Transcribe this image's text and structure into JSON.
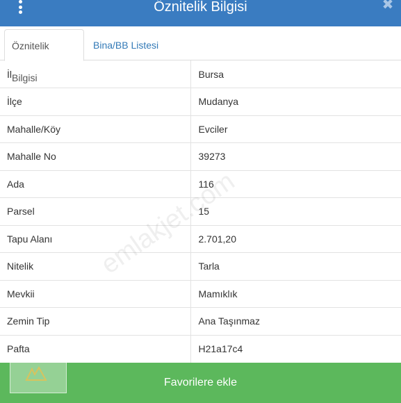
{
  "header": {
    "title": "Öznitelik Bilgisi",
    "close_symbol": "✖"
  },
  "tabs": [
    {
      "label": "Öznitelik Bilgisi",
      "active": true
    },
    {
      "label": "Bina/BB Listesi",
      "active": false
    }
  ],
  "attributes": [
    {
      "key": "İl",
      "value": "Bursa"
    },
    {
      "key": "İlçe",
      "value": "Mudanya"
    },
    {
      "key": "Mahalle/Köy",
      "value": "Evciler"
    },
    {
      "key": "Mahalle No",
      "value": "39273"
    },
    {
      "key": "Ada",
      "value": "116"
    },
    {
      "key": "Parsel",
      "value": "15"
    },
    {
      "key": "Tapu Alanı",
      "value": "2.701,20"
    },
    {
      "key": "Nitelik",
      "value": "Tarla"
    },
    {
      "key": "Mevkii",
      "value": "Mamıklık"
    },
    {
      "key": "Zemin Tip",
      "value": "Ana Taşınmaz"
    },
    {
      "key": "Pafta",
      "value": "H21a17c4"
    }
  ],
  "footer": {
    "favorite_label": "Favorilere ekle"
  },
  "watermark": "emlakjet.com",
  "colors": {
    "header_bg": "#3a7cc1",
    "favorite_bg": "#5cb85c",
    "tab_link": "#337ab7"
  }
}
